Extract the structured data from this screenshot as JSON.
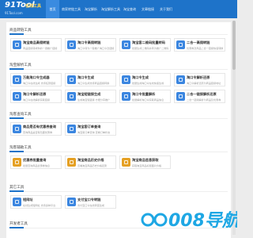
{
  "brand": {
    "logo_text": "91Tool",
    "logo_tag": "在线工具",
    "logo_sub": "91Tool.com"
  },
  "nav": [
    {
      "label": "首页",
      "active": true
    },
    {
      "label": "商家转链工具",
      "active": false
    },
    {
      "label": "淘宝解析",
      "active": false
    },
    {
      "label": "淘宝解析工具",
      "active": false
    },
    {
      "label": "淘宝查询",
      "active": false
    },
    {
      "label": "文章链接",
      "active": false
    },
    {
      "label": "关于我们",
      "active": false
    }
  ],
  "sections": [
    {
      "title": "商品转链工具",
      "cards": [
        {
          "title": "淘宝商品高佣转链",
          "desc": "商品链接转成你的一键推广链接",
          "color": "#3b86e0"
        },
        {
          "title": "淘口令高佣转链",
          "desc": "淘口令转为一键推广淘口令及链接",
          "color": "#3b86e0"
        },
        {
          "title": "淘宝客二维码批量转码",
          "desc": "批量生成二维码并转为推广二维码",
          "color": "#3b86e0"
        },
        {
          "title": "二合一高佣转链",
          "desc": "优惠券及商品二合一链接快速转换",
          "color": "#3b86e0"
        }
      ]
    },
    {
      "title": "淘宝解析工具",
      "cards": [
        {
          "title": "万能淘口令生成器",
          "desc": "淘口令在线生成 支持任意链接",
          "color": "#3b86e0"
        },
        {
          "title": "淘口令生成",
          "desc": "淘口令生成支持商品链接转换",
          "color": "#3b86e0"
        },
        {
          "title": "淘口令生成",
          "desc": "批量生成淘口令在线快速生成",
          "color": "#3b86e0"
        },
        {
          "title": "淘口令解析还原",
          "desc": "淘口令解析还原为商品链接地址",
          "color": "#3b86e0"
        },
        {
          "title": "淘口令解析还原",
          "desc": "淘口令在线解析获取链接",
          "color": "#3b86e0"
        },
        {
          "title": "淘宝短链接生成",
          "desc": "生成淘宝短链接 方便分享推广",
          "color": "#3b86e0"
        },
        {
          "title": "淘口令批量解析",
          "desc": "批量解析淘口令获取商品信息",
          "color": "#3b86e0"
        },
        {
          "title": "二合一链接解析还原",
          "desc": "二合一链接解析为商品及优惠券",
          "color": "#3b86e0"
        }
      ]
    },
    {
      "title": "淘客查询工具",
      "cards": [
        {
          "title": "商品是否有优惠券查询",
          "desc": "查询商品是否有隐藏优惠券",
          "color": "#3b86e0"
        },
        {
          "title": "淘宝客订单查询",
          "desc": "淘宝客订单查询 查看订单状态",
          "color": "#3b86e0"
        }
      ]
    },
    {
      "title": "淘客辅助工具",
      "cards": [
        {
          "title": "优惠券批量查询",
          "desc": "批量查询商品优惠券信息",
          "color": "#e5a023"
        },
        {
          "title": "淘宝商品历史价格",
          "desc": "查看淘宝商品历史价格走势",
          "color": "#e5a023"
        },
        {
          "title": "淘宝商品信息获取",
          "desc": "获取淘宝商品标题图片价格",
          "color": "#e5a023"
        }
      ]
    },
    {
      "title": "其它工具",
      "cards": [
        {
          "title": "短网址",
          "desc": "在线生成短网址 支持多种平台",
          "color": "#3b86e0"
        },
        {
          "title": "支付宝口令转链",
          "desc": "支付宝口令在线转链生成",
          "color": "#3b86e0"
        }
      ]
    },
    {
      "title": "开发者工具",
      "cards": []
    }
  ],
  "watermark": {
    "text": "008导航",
    "color": "#1ea7e4"
  }
}
